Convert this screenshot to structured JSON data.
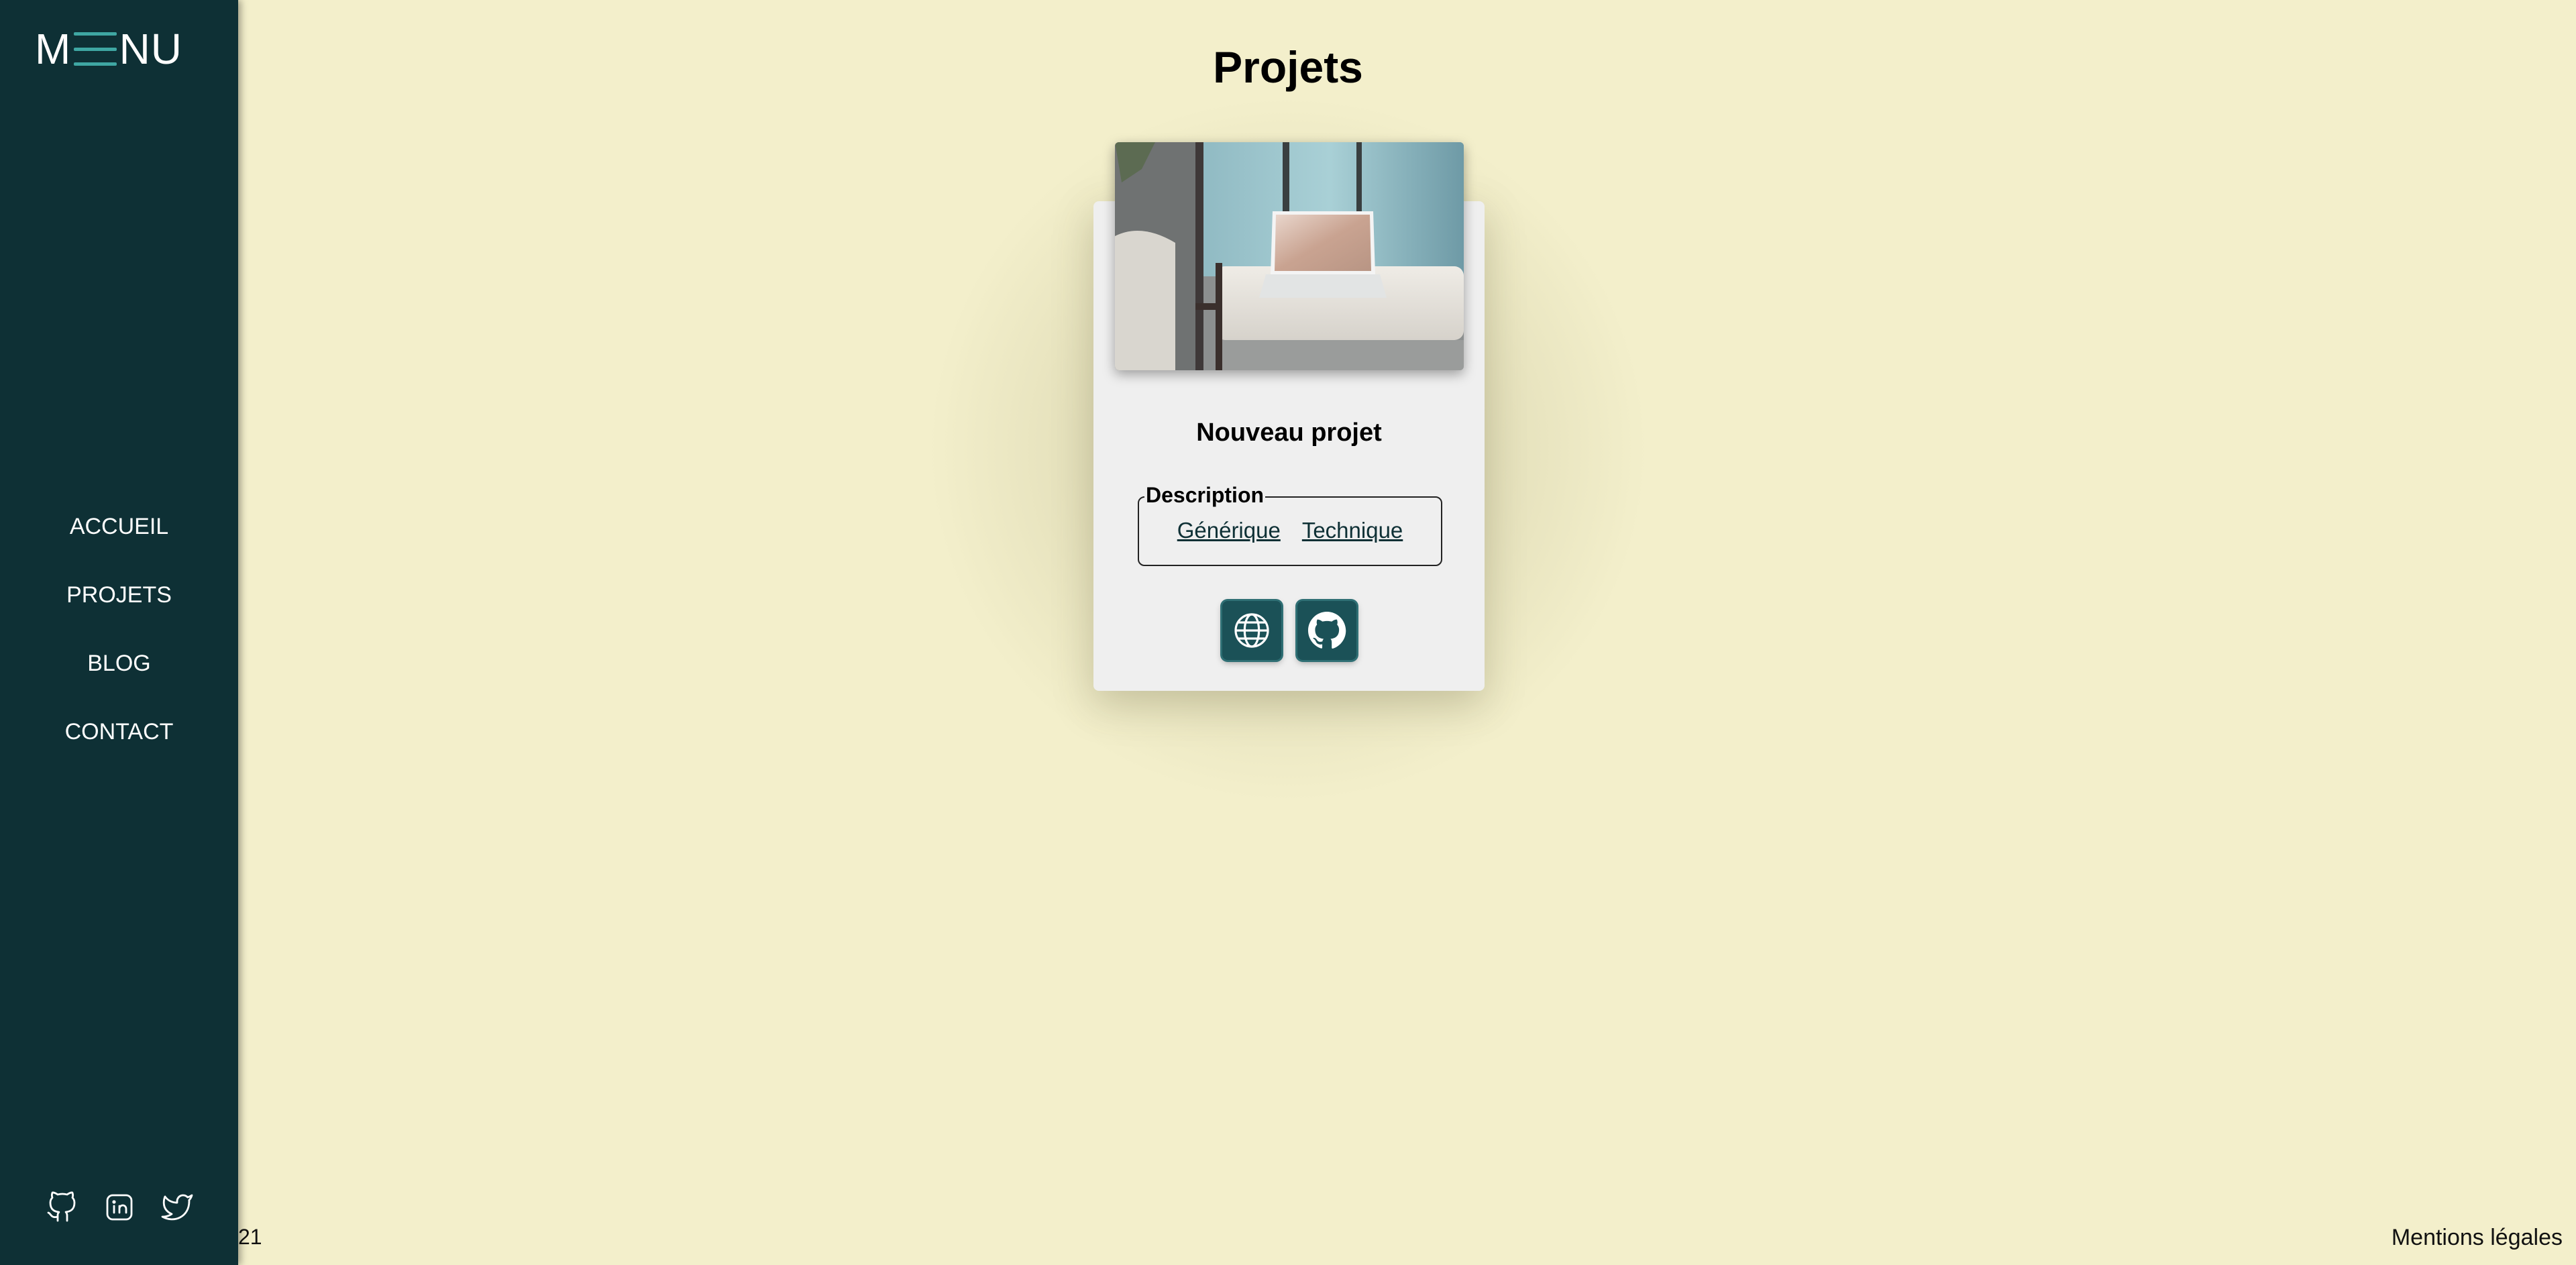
{
  "sidebar": {
    "logo": {
      "left": "M",
      "right": "NU"
    },
    "nav": [
      {
        "label": "ACCUEIL"
      },
      {
        "label": "PROJETS"
      },
      {
        "label": "BLOG"
      },
      {
        "label": "CONTACT"
      }
    ],
    "socials": [
      {
        "icon": "github-icon"
      },
      {
        "icon": "linkedin-icon"
      },
      {
        "icon": "twitter-icon"
      }
    ]
  },
  "main": {
    "title": "Projets",
    "card": {
      "title": "Nouveau projet",
      "description_legend": "Description",
      "links": [
        "Générique",
        "Technique"
      ],
      "actions": [
        {
          "icon": "globe-icon"
        },
        {
          "icon": "github-icon"
        }
      ]
    }
  },
  "footer": {
    "left_text": "21",
    "right_text": "Mentions légales"
  },
  "colors": {
    "background": "#f3efcb",
    "sidebar": "#0e3035",
    "accent": "#3fa7a3",
    "button": "#1b5157",
    "card": "#efefef"
  }
}
